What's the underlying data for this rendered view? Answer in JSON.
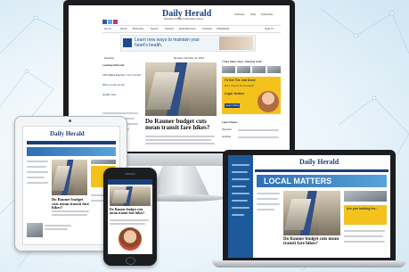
{
  "publication": {
    "name": "Daily Herald",
    "tagline": "Suburban Chicago's Information Source"
  },
  "monitor": {
    "top_links": [
      "Archives",
      "Help",
      "Subscribe"
    ],
    "nav_items": [
      "Home",
      "News",
      "Business",
      "Sports",
      "Opinion",
      "Entertainment",
      "Lifestyle",
      "Classifieds",
      "Search"
    ],
    "ad_headline": "Learn new ways to maintain your heart's health.",
    "date": "Monday, February 23, 2015",
    "weather_label": "Weather",
    "left_headlines": [
      "Leading Editorial",
      "Fifth-Ballot Election 'not in doubt'",
      "Wins round out list",
      "Health care"
    ],
    "main_headline": "Do Rauner budget cuts mean transit fare hikes?",
    "promo_top": "7 Day Sales Sure, Starting at $7",
    "promo_text": [
      "I'll Get The Job Done",
      "But I Trust It To A Lawyer",
      "Legal Justice",
      "Learn More"
    ],
    "sidebar_heading": "Latest News",
    "sidebar_items": [
      "Weather",
      "Holiday"
    ]
  },
  "tablet": {
    "headline": "Do Rauner budget cuts mean transit fare hikes?"
  },
  "phone": {
    "headline": "Do Rauner budget cuts mean transit fare hikes?"
  },
  "laptop": {
    "banner": "LOCAL MATTERS",
    "headline": "Do Rauner budget cuts mean transit fare hikes?",
    "side_ad": "Are you looking for..."
  },
  "colors": {
    "brand_blue": "#1a3e7a",
    "accent_yellow": "#f4c21d",
    "device_dark": "#1c1d20",
    "device_silver": "#d9dde1"
  }
}
